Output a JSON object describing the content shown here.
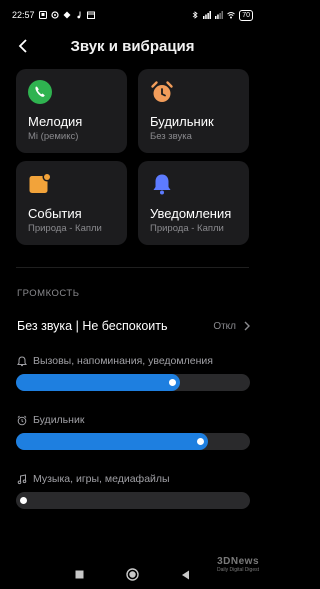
{
  "status_bar": {
    "time": "22:57",
    "battery": "70"
  },
  "header": {
    "title": "Звук и вибрация"
  },
  "tiles": [
    {
      "label": "Мелодия",
      "sub": "Mi (ремикс)",
      "icon": "phone-icon",
      "color": "#2fb350"
    },
    {
      "label": "Будильник",
      "sub": "Без звука",
      "icon": "alarm-clock-icon",
      "color": "#f19c5a"
    },
    {
      "label": "События",
      "sub": "Природа - Капли",
      "icon": "calendar-event-icon",
      "color": "#f2a33a"
    },
    {
      "label": "Уведомления",
      "sub": "Природа - Капли",
      "icon": "bell-icon",
      "color": "#5d7bff"
    }
  ],
  "volume": {
    "section_title": "ГРОМКОСТЬ",
    "dnd_label": "Без звука | Не беспокоить",
    "dnd_value": "Откл",
    "sliders": [
      {
        "label": "Вызовы, напоминания, уведомления",
        "icon": "bell-outline-icon",
        "level": 0.68
      },
      {
        "label": "Будильник",
        "icon": "alarm-outline-icon",
        "level": 0.81
      },
      {
        "label": "Музыка, игры, медиафайлы",
        "icon": "music-note-icon",
        "level": 0.0
      }
    ]
  },
  "watermark": {
    "logo": "3DNews",
    "sub": "Daily Digital Digest"
  },
  "colors": {
    "background": "#000000",
    "tile": "#1c1c1e",
    "accent": "#1e7fe0",
    "track": "#2a2a2c"
  }
}
